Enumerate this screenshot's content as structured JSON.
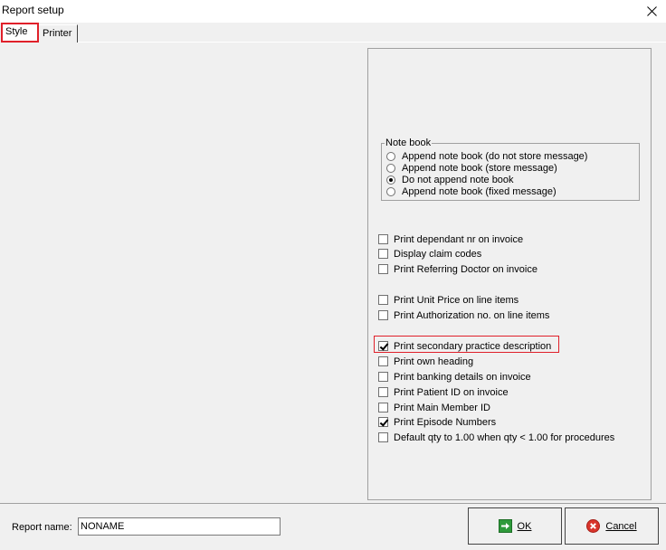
{
  "window": {
    "title": "Report setup",
    "close_icon": "close-icon"
  },
  "tabs": [
    {
      "label": "Style",
      "selected": true
    },
    {
      "label": "Printer",
      "selected": false
    }
  ],
  "notebook": {
    "title": "Note book",
    "options": [
      {
        "label": "Append note book (do not store message)",
        "selected": false
      },
      {
        "label": "Append note book (store message)",
        "selected": false
      },
      {
        "label": "Do not append note book",
        "selected": true
      },
      {
        "label": "Append note book (fixed message)",
        "selected": false
      }
    ]
  },
  "checks": [
    {
      "label": "Print dependant nr on invoice",
      "checked": false
    },
    {
      "label": "Display claim codes",
      "checked": false
    },
    {
      "label": "Print Referring Doctor on invoice",
      "checked": false
    },
    {
      "label": "Print Unit Price on line items",
      "checked": false
    },
    {
      "label": "Print Authorization no. on line items",
      "checked": false
    },
    {
      "label": "Print secondary practice description",
      "checked": true
    },
    {
      "label": "Print own heading",
      "checked": false
    },
    {
      "label": "Print banking details on invoice",
      "checked": false
    },
    {
      "label": "Print Patient ID on invoice",
      "checked": false
    },
    {
      "label": "Print Main Member ID",
      "checked": false
    },
    {
      "label": "Print Episode Numbers",
      "checked": true
    },
    {
      "label": "Default qty to 1.00 when qty < 1.00 for procedures",
      "checked": false
    }
  ],
  "footer": {
    "report_name_label": "Report name:",
    "report_name_value": "NONAME",
    "ok_label": "OK",
    "cancel_label": "Cancel",
    "ok_icon": "ok-arrow-icon",
    "cancel_icon": "cancel-x-icon",
    "ok_color": "#2e9a3a",
    "cancel_color": "#d9342b"
  },
  "colors": {
    "highlight": "#e0202a",
    "background": "#f0f0f0"
  }
}
